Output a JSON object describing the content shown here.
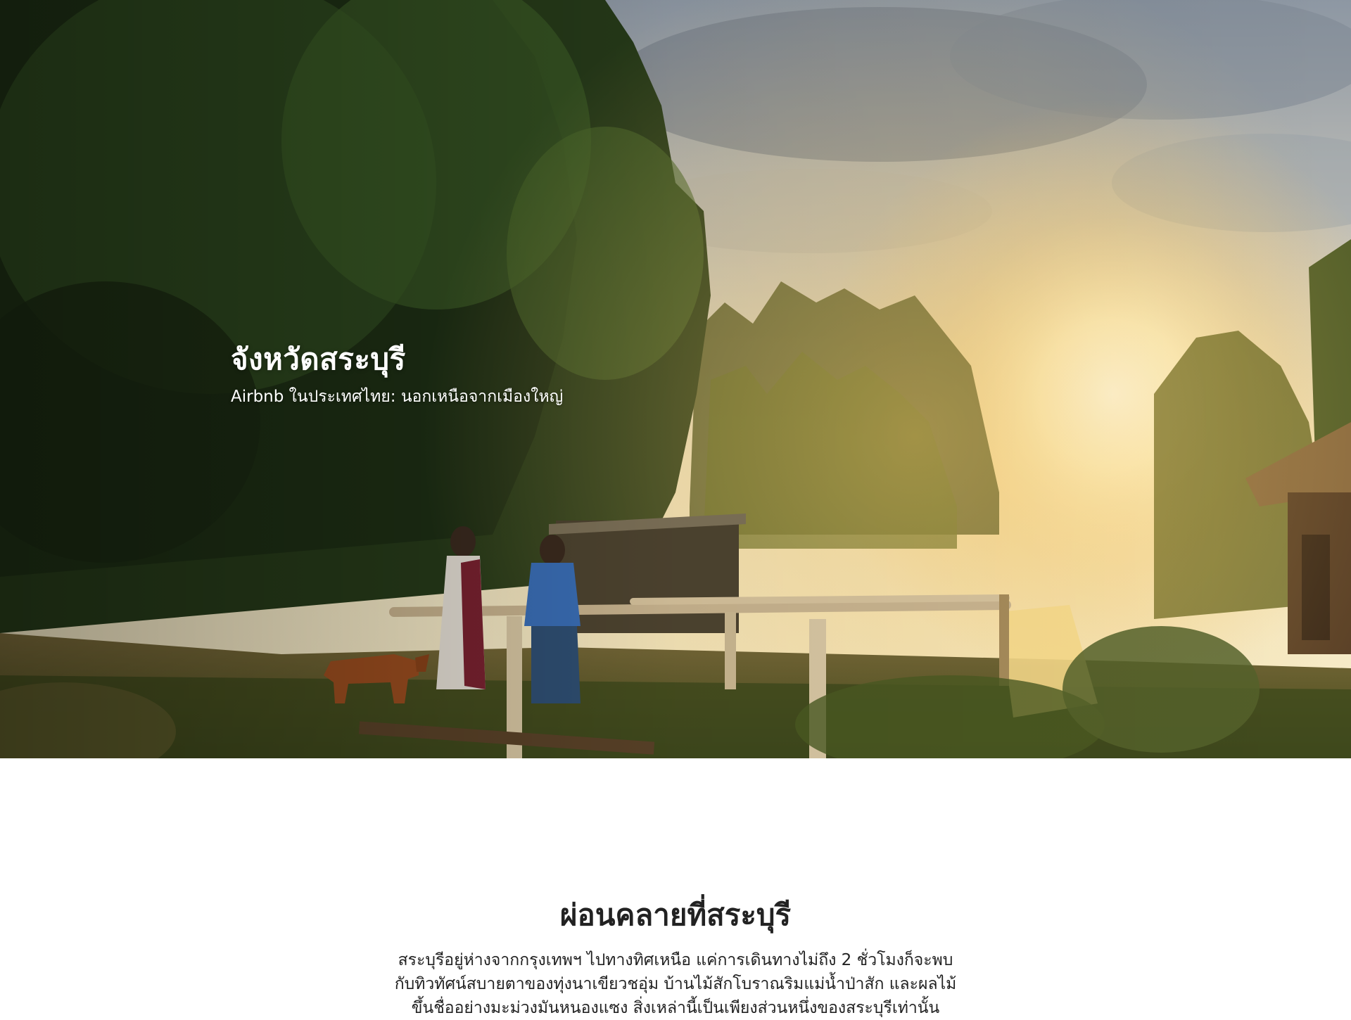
{
  "hero": {
    "title": "จังหวัดสระบุรี",
    "subtitle": "Airbnb ในประเทศไทย: นอกเหนือจากเมืองใหญ่",
    "image_alt": "photo-sunset-countryside-women-walking-dog"
  },
  "intro": {
    "heading": "ผ่อนคลายที่สระบุรี",
    "body_lines": [
      "สระบุรีอยู่ห่างจากกรุงเทพฯ ไปทางทิศเหนือ แค่การเดินทางไม่ถึง 2 ชั่วโมงก็จะพบ",
      "กับทิวทัศน์สบายตาของทุ่งนาเขียวชอุ่ม บ้านไม้สักโบราณริมแม่น้ำป่าสัก และผลไม้",
      "ขึ้นชื่ออย่างมะม่วงมันหนองแซง สิ่งเหล่านี้เป็นเพียงส่วนหนึ่งของสระบุรีเท่านั้น"
    ]
  },
  "colors": {
    "text_dark": "#222222",
    "hero_text": "#ffffff",
    "page_bg": "#ffffff"
  }
}
